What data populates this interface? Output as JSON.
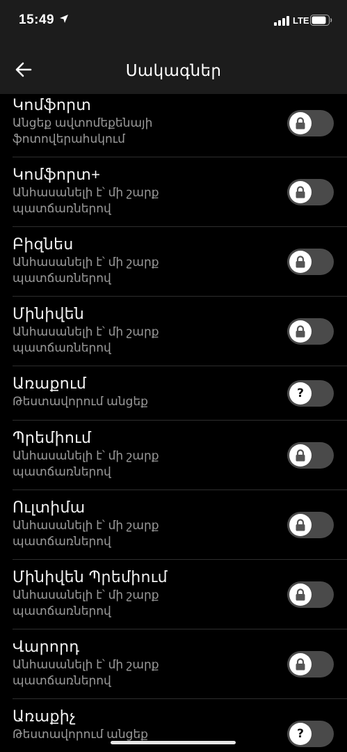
{
  "status_bar": {
    "time": "15:49",
    "network": "LTE"
  },
  "header": {
    "title": "Սակագներ"
  },
  "tariffs": [
    {
      "name": "Կոմֆորտ",
      "subtitle": "Անցեք ավտոմեքենայի ֆոտովերահսկում",
      "toggle": "lock-icon"
    },
    {
      "name": "Կոմֆորտ+",
      "subtitle": "Անհասանելի է՝ մի շարք պատճառներով",
      "toggle": "lock-icon"
    },
    {
      "name": "Բիզնես",
      "subtitle": "Անհասանելի է՝ մի շարք պատճառներով",
      "toggle": "lock-icon"
    },
    {
      "name": "Մինիվեն",
      "subtitle": "Անհասանելի է՝ մի շարք պատճառներով",
      "toggle": "lock-icon"
    },
    {
      "name": "Առաքում",
      "subtitle": "Թեստավորում անցեք",
      "toggle": "question-icon"
    },
    {
      "name": "Պրեմիում",
      "subtitle": "Անհասանելի է՝ մի շարք պատճառներով",
      "toggle": "lock-icon"
    },
    {
      "name": "Ուլտիմա",
      "subtitle": "Անհասանելի է՝ մի շարք պատճառներով",
      "toggle": "lock-icon"
    },
    {
      "name": "Մինիվեն Պրեմիում",
      "subtitle": "Անհասանելի է՝ մի շարք պատճառներով",
      "toggle": "lock-icon"
    },
    {
      "name": "Վարորդ",
      "subtitle": "Անհասանելի է՝ մի շարք պատճառներով",
      "toggle": "lock-icon"
    },
    {
      "name": "Առաքիչ",
      "subtitle": "Թեստավորում անցեք",
      "toggle": "question-icon"
    }
  ],
  "colors": {
    "background": "#000000",
    "header": "#1c1c1c",
    "toggle_track": "#4a4a4a",
    "subtitle": "#9a9a9a"
  }
}
